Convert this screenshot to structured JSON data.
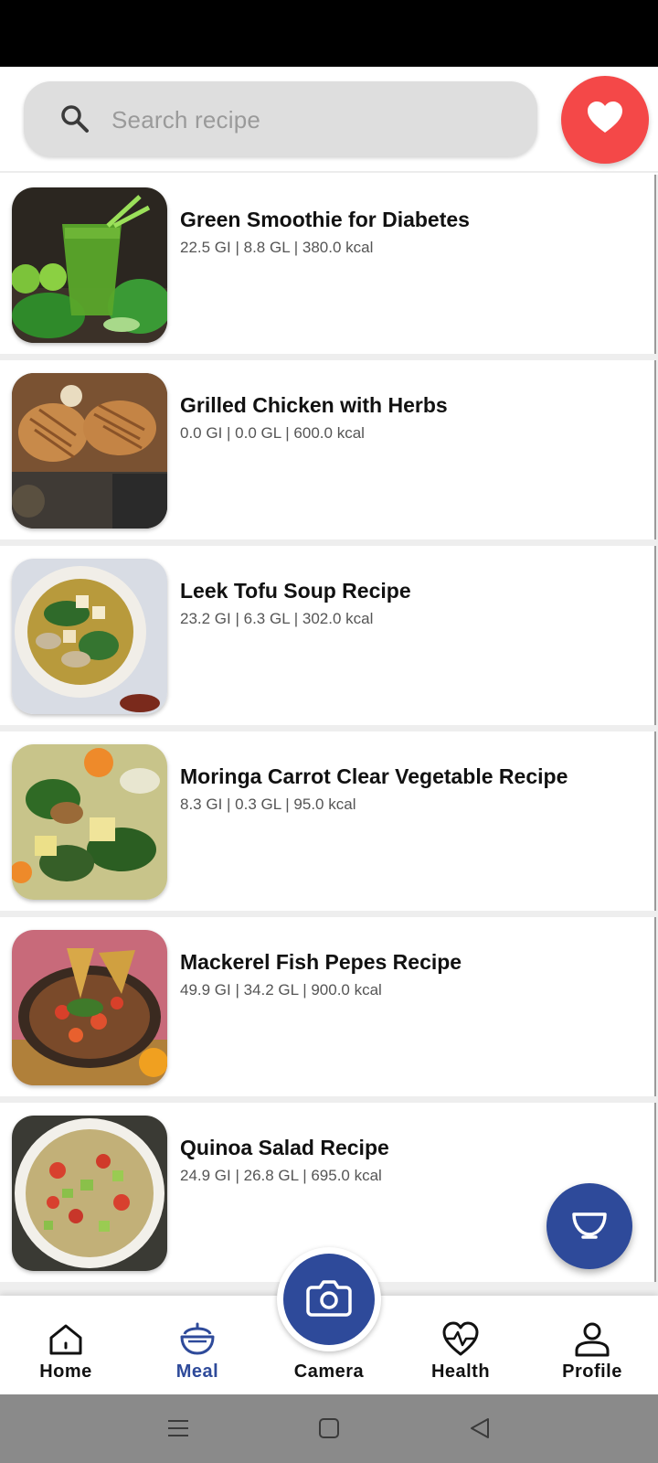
{
  "search": {
    "placeholder": "Search recipe",
    "icon": "search-icon"
  },
  "favorites": {
    "icon": "heart-icon",
    "color": "#f44848"
  },
  "recipes": [
    {
      "title": "Green Smoothie for Diabetes",
      "stats": "22.5 GI  |  8.8 GL  |  380.0 kcal",
      "image": "green-smoothie"
    },
    {
      "title": "Grilled Chicken with Herbs",
      "stats": "0.0 GI  |  0.0 GL  |  600.0 kcal",
      "image": "grilled-chicken"
    },
    {
      "title": "Leek Tofu Soup Recipe",
      "stats": "23.2 GI  |  6.3 GL  |  302.0 kcal",
      "image": "leek-tofu-soup"
    },
    {
      "title": "Moringa Carrot Clear Vegetable Recipe",
      "stats": "8.3 GI  |  0.3 GL  |  95.0 kcal",
      "image": "moringa-carrot-soup"
    },
    {
      "title": "Mackerel Fish Pepes Recipe",
      "stats": "49.9 GI  |  34.2 GL  |  900.0 kcal",
      "image": "mackerel-fish-pepes"
    },
    {
      "title": "Quinoa Salad Recipe",
      "stats": "24.9 GI  |  26.8 GL  |  695.0 kcal",
      "image": "quinoa-salad"
    }
  ],
  "fab": {
    "icon": "bowl-icon",
    "color": "#2e4a9a"
  },
  "nav": {
    "active": "Meal",
    "accent": "#2e4a9a",
    "items": [
      {
        "label": "Home",
        "icon": "home-icon"
      },
      {
        "label": "Meal",
        "icon": "meal-icon"
      },
      {
        "label": "Camera",
        "icon": "camera-icon"
      },
      {
        "label": "Health",
        "icon": "heart-pulse-icon"
      },
      {
        "label": "Profile",
        "icon": "profile-icon"
      }
    ]
  },
  "system_nav": {
    "items": [
      "menu-icon",
      "home-square-icon",
      "back-triangle-icon"
    ]
  }
}
